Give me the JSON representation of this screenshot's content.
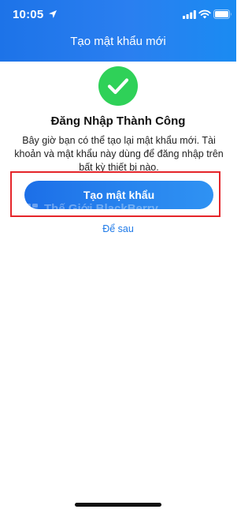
{
  "status_bar": {
    "time": "10:05"
  },
  "header": {
    "title": "Tạo mật khẩu mới"
  },
  "content": {
    "success_title": "Đăng Nhập Thành Công",
    "description": "Bây giờ bạn có thể tạo lại mật khẩu mới. Tài khoản và mật khẩu này dùng để đăng nhập trên bất kỳ thiết bị nào.",
    "primary_button": "Tạo mật khẩu",
    "secondary_link": "Để sau"
  },
  "watermark": {
    "text": "Thế Giới BlackBerry"
  },
  "colors": {
    "header_blue": "#1d73e8",
    "success_green": "#2fd158",
    "button_blue": "#2884ee",
    "highlight_red": "#e5252a",
    "link_blue": "#1f7ae8"
  },
  "icons": {
    "location": "location-arrow-icon",
    "signal": "cellular-signal-icon",
    "wifi": "wifi-icon",
    "battery": "battery-icon",
    "success": "checkmark-circle-icon"
  }
}
